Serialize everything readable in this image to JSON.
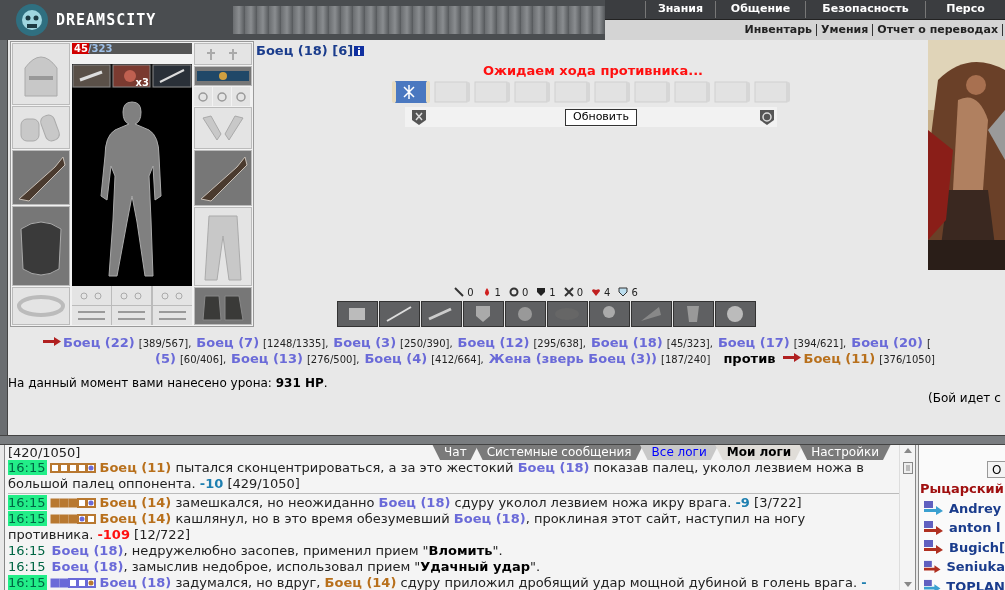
{
  "header": {
    "logo": "DREAMSCITY",
    "menu": [
      {
        "label": "Знания"
      },
      {
        "label": "Общение"
      },
      {
        "label": "Безопасность"
      },
      {
        "label": "Персо"
      }
    ],
    "submenu": [
      {
        "label": "Инвентарь"
      },
      {
        "label": "Умения"
      },
      {
        "label": "Отчет о переводах"
      }
    ]
  },
  "character": {
    "hp_current": "45",
    "hp_max": "/323",
    "level": 0.14,
    "ammo_count": "x3"
  },
  "player": {
    "name": "Боец (18) [6]"
  },
  "status": "Ожидаем хода противника...",
  "scrolls": [
    {
      "filled": true
    },
    {
      "filled": false
    },
    {
      "filled": false
    },
    {
      "filled": false
    },
    {
      "filled": false
    },
    {
      "filled": false
    },
    {
      "filled": false
    },
    {
      "filled": false
    },
    {
      "filled": false
    },
    {
      "filled": false
    }
  ],
  "refresh_button": "Обновить",
  "stats": [
    {
      "kind": "sword",
      "value": "0"
    },
    {
      "kind": "drop",
      "value": "1"
    },
    {
      "kind": "swirl",
      "value": "0"
    },
    {
      "kind": "shield",
      "value": "1"
    },
    {
      "kind": "cross",
      "value": "0"
    },
    {
      "kind": "heart",
      "value": "4"
    },
    {
      "kind": "guard",
      "value": "6"
    }
  ],
  "battle_lines": [
    [
      {
        "kind": "arrow"
      },
      {
        "kind": "ally",
        "name": "Боец (22)",
        "hp": "[389/567],"
      },
      {
        "kind": "ally",
        "name": "Боец (7)",
        "hp": "[1248/1335],"
      },
      {
        "kind": "ally",
        "name": "Боец (3)",
        "hp": "[250/390],"
      },
      {
        "kind": "ally",
        "name": "Боец (12)",
        "hp": "[295/638],"
      },
      {
        "kind": "ally",
        "name": "Боец (18)",
        "hp": "[45/323],"
      },
      {
        "kind": "ally",
        "name": "Боец (17)",
        "hp": "[394/621],"
      },
      {
        "kind": "ally",
        "name": "Боец (20)",
        "hp": "["
      }
    ],
    [
      {
        "kind": "ally",
        "name": "(5)",
        "hp": "[60/406],"
      },
      {
        "kind": "ally",
        "name": "Боец (13)",
        "hp": "[276/500],"
      },
      {
        "kind": "ally",
        "name": "Боец (4)",
        "hp": "[412/664],"
      },
      {
        "kind": "ally",
        "name": "Жена (зверь Боец (3))",
        "hp": "[187/240]"
      },
      {
        "kind": "word",
        "text": "против"
      },
      {
        "kind": "arrow"
      },
      {
        "kind": "enemy",
        "name": "Боец (11)",
        "hp": "[376/1050]"
      }
    ]
  ],
  "damage_text": "На данный момент вами нанесено урона: **931 HP**.",
  "battle_note": "(Бой идет с",
  "log": {
    "tabs": [
      {
        "label": "Чат",
        "selected": false,
        "kind": "plain"
      },
      {
        "label": "Системные сообщения",
        "selected": false,
        "kind": "plain"
      },
      {
        "label": "Все логи",
        "selected": false,
        "kind": "link"
      },
      {
        "label": "Мои логи",
        "selected": true,
        "kind": "plain"
      },
      {
        "label": "Настройки",
        "selected": false,
        "kind": "plain"
      }
    ],
    "top_fragment": "[420/1050]",
    "entries": [
      {
        "time": "16:15",
        "time_highlight": true,
        "zones": [
          {
            "kind": "empty"
          },
          {
            "kind": "empty"
          },
          {
            "kind": "empty"
          },
          {
            "kind": "empty"
          },
          {
            "kind": "dot",
            "color": "#6a6ad8"
          }
        ],
        "color": "#b87830",
        "divider": true,
        "parts": [
          {
            "kind": "enemy",
            "t": "Боец (11)"
          },
          {
            "kind": "plain",
            "t": " пытался сконцентрироваться, а за это жестокий "
          },
          {
            "kind": "ally",
            "t": "Боец (18)"
          },
          {
            "kind": "plain",
            "t": " показав палец, уколол лезвием ножа в большой палец оппонента. "
          },
          {
            "kind": "damage",
            "t": "-10"
          },
          {
            "kind": "plain",
            "t": " [429/1050]"
          }
        ]
      },
      {
        "time": "16:15",
        "time_highlight": true,
        "zones": [
          {
            "kind": "filled"
          },
          {
            "kind": "filled"
          },
          {
            "kind": "filled"
          },
          {
            "kind": "empty"
          },
          {
            "kind": "dot",
            "color": "#6a6ad8"
          }
        ],
        "color": "#b87830",
        "divider": false,
        "parts": [
          {
            "kind": "enemy",
            "t": "Боец (14)"
          },
          {
            "kind": "plain",
            "t": " замешкался, но неожиданно "
          },
          {
            "kind": "ally",
            "t": "Боец (18)"
          },
          {
            "kind": "plain",
            "t": " сдуру уколол лезвием ножа икру врага. "
          },
          {
            "kind": "damage",
            "t": "-9"
          },
          {
            "kind": "plain",
            "t": " [3/722]"
          }
        ]
      },
      {
        "time": "16:15",
        "time_highlight": true,
        "zones": [
          {
            "kind": "filled"
          },
          {
            "kind": "filled"
          },
          {
            "kind": "filled"
          },
          {
            "kind": "dot",
            "color": "#6a6ad8"
          },
          {
            "kind": "empty"
          }
        ],
        "color": "#b87830",
        "divider": false,
        "parts": [
          {
            "kind": "enemy",
            "t": "Боец (14)"
          },
          {
            "kind": "plain",
            "t": " кашлянул, но в это время обезумевший "
          },
          {
            "kind": "ally",
            "t": "Боец (18)"
          },
          {
            "kind": "plain",
            "t": ", проклиная этот сайт, наступил на ногу противника. "
          },
          {
            "kind": "critical",
            "t": "-109"
          },
          {
            "kind": "plain",
            "t": " [12/722]"
          }
        ]
      },
      {
        "time": "16:15",
        "time_highlight": false,
        "divider": false,
        "parts": [
          {
            "kind": "ally",
            "t": "Боец (18)"
          },
          {
            "kind": "plain",
            "t": ", недружелюбно засопев, применил прием \""
          },
          {
            "kind": "bold",
            "t": "Вломить"
          },
          {
            "kind": "plain",
            "t": "\"."
          }
        ]
      },
      {
        "time": "16:15",
        "time_highlight": false,
        "divider": false,
        "parts": [
          {
            "kind": "ally",
            "t": "Боец (18)"
          },
          {
            "kind": "plain",
            "t": ", замыслив недоброе, использовал прием \""
          },
          {
            "kind": "bold",
            "t": "Удачный удар"
          },
          {
            "kind": "plain",
            "t": "\"."
          }
        ]
      },
      {
        "time": "16:15",
        "time_highlight": true,
        "zones": [
          {
            "kind": "filled"
          },
          {
            "kind": "filled"
          },
          {
            "kind": "empty"
          },
          {
            "kind": "empty"
          },
          {
            "kind": "dot",
            "color": "#b87830"
          }
        ],
        "color": "#6a6ad8",
        "divider": false,
        "parts": [
          {
            "kind": "ally",
            "t": "Боец (18)"
          },
          {
            "kind": "plain",
            "t": " задумался, но вдруг, "
          },
          {
            "kind": "enemy",
            "t": "Боец (14)"
          },
          {
            "kind": "plain",
            "t": " сдуру приложил дробящий удар мощной дубиной в голень врага. "
          },
          {
            "kind": "damage",
            "t": "-"
          }
        ]
      }
    ]
  },
  "side_panel": {
    "button": "О",
    "title": "Рыцарский",
    "members": [
      {
        "name": "Andrey",
        "color": "#3aa0d0"
      },
      {
        "name": "anton l",
        "color": "#b03020"
      },
      {
        "name": "Bugich[",
        "color": "#b03020"
      },
      {
        "name": "Seniuka",
        "color": "#b03020"
      },
      {
        "name": "TOPLAN",
        "color": "#3aa0d0"
      }
    ]
  }
}
